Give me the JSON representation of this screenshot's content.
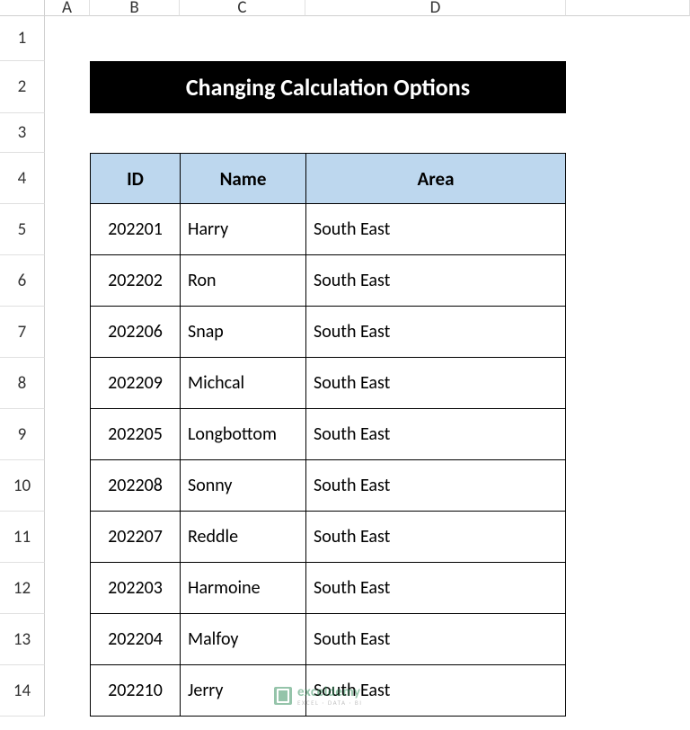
{
  "columns": [
    "A",
    "B",
    "C",
    "D"
  ],
  "row_numbers": [
    "1",
    "2",
    "3",
    "4",
    "5",
    "6",
    "7",
    "8",
    "9",
    "10",
    "11",
    "12",
    "13",
    "14"
  ],
  "title": "Changing Calculation Options",
  "headers": {
    "id": "ID",
    "name": "Name",
    "area": "Area"
  },
  "chart_data": {
    "type": "table",
    "columns": [
      "ID",
      "Name",
      "Area"
    ],
    "rows": [
      {
        "id": "202201",
        "name": "Harry",
        "area": "South East"
      },
      {
        "id": "202202",
        "name": "Ron",
        "area": "South East"
      },
      {
        "id": "202206",
        "name": "Snap",
        "area": "South East"
      },
      {
        "id": "202209",
        "name": "Michcal",
        "area": "South East"
      },
      {
        "id": "202205",
        "name": "Longbottom",
        "area": "South East"
      },
      {
        "id": "202208",
        "name": "Sonny",
        "area": "South East"
      },
      {
        "id": "202207",
        "name": "Reddle",
        "area": "South East"
      },
      {
        "id": "202203",
        "name": "Harmoine",
        "area": "South East"
      },
      {
        "id": "202204",
        "name": "Malfoy",
        "area": "South East"
      },
      {
        "id": "202210",
        "name": "Jerry",
        "area": "South East"
      }
    ]
  },
  "watermark": {
    "main": "exceldemy",
    "sub": "EXCEL · DATA · BI"
  }
}
